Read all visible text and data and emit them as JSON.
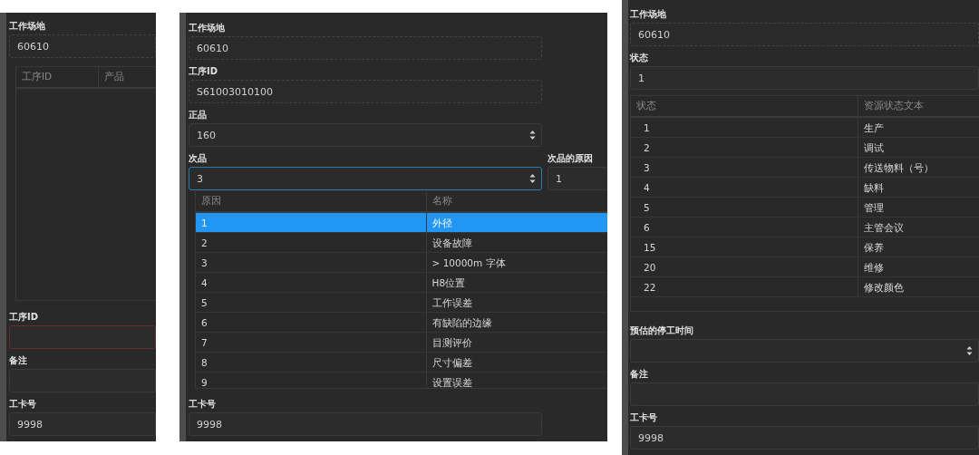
{
  "panels": [
    {
      "items": [
        {
          "kind": "field",
          "label": "工作场地",
          "value": "60610",
          "readonly": true,
          "spinner": false
        },
        {
          "kind": "table",
          "columns": [
            "工序ID",
            "产品"
          ]
        },
        {
          "kind": "field",
          "label": "工序ID",
          "invalid": true,
          "spinner": false
        },
        {
          "kind": "field",
          "label": "备注",
          "spinner": false
        },
        {
          "kind": "field",
          "label": "工卡号",
          "value": "9998",
          "spinner": false
        }
      ]
    },
    {
      "items": [
        {
          "kind": "field",
          "label": "工作场地",
          "value": "60610",
          "readonly": true,
          "spinner": false
        },
        {
          "kind": "field",
          "label": "工序ID",
          "value": "S61003010100",
          "readonly": true,
          "spinner": false
        },
        {
          "kind": "field",
          "label": "正品",
          "value": "160",
          "spinner": true
        },
        {
          "kind": "row",
          "fields": [
            {
              "label": "次品",
              "value": "3",
              "focused": true,
              "spinner": true
            },
            {
              "label": "次品的原因",
              "value": "1"
            }
          ]
        },
        {
          "kind": "dropdown",
          "columns": [
            "原因",
            "名称"
          ],
          "rows": [
            {
              "cells": [
                "1",
                "外径"
              ],
              "selected": true
            },
            {
              "cells": [
                "2",
                "设备故障"
              ],
              "selected": false
            },
            {
              "cells": [
                "3",
                "> 10000m 字体"
              ],
              "selected": false
            },
            {
              "cells": [
                "4",
                "H8位置"
              ],
              "selected": false
            },
            {
              "cells": [
                "5",
                "工作误差"
              ],
              "selected": false
            },
            {
              "cells": [
                "6",
                "有缺陷的边缘"
              ],
              "selected": false
            },
            {
              "cells": [
                "7",
                "目测评价"
              ],
              "selected": false
            },
            {
              "cells": [
                "8",
                "尺寸偏差"
              ],
              "selected": false
            },
            {
              "cells": [
                "9",
                "设置误差"
              ],
              "selected": false
            }
          ]
        },
        {
          "kind": "field",
          "label": "工卡号",
          "value": "9998",
          "spinner": false
        }
      ]
    },
    {
      "items": [
        {
          "kind": "field",
          "label": "工作场地",
          "value": "60610",
          "readonly": true,
          "spinner": false
        },
        {
          "kind": "field",
          "label": "状态",
          "value": "1",
          "spinner": false
        },
        {
          "kind": "table",
          "columns": [
            "状态",
            "资源状态文本"
          ],
          "rows": [
            {
              "cells": [
                "1",
                "生产"
              ],
              "selected": false
            },
            {
              "cells": [
                "2",
                "调试"
              ],
              "selected": false
            },
            {
              "cells": [
                "3",
                "传送物料（号）"
              ],
              "selected": false
            },
            {
              "cells": [
                "4",
                "缺料"
              ],
              "selected": false
            },
            {
              "cells": [
                "5",
                "管理"
              ],
              "selected": false
            },
            {
              "cells": [
                "6",
                "主管会议"
              ],
              "selected": false
            },
            {
              "cells": [
                "15",
                "保养"
              ],
              "selected": false
            },
            {
              "cells": [
                "20",
                "维修"
              ],
              "selected": false
            },
            {
              "cells": [
                "22",
                "修改颜色"
              ],
              "selected": false
            }
          ]
        },
        {
          "kind": "field",
          "label": "预估的停工时间",
          "spinner": true
        },
        {
          "kind": "field",
          "label": "备注",
          "spinner": false
        },
        {
          "kind": "field",
          "label": "工卡号",
          "value": "9998",
          "spinner": false
        }
      ]
    }
  ]
}
